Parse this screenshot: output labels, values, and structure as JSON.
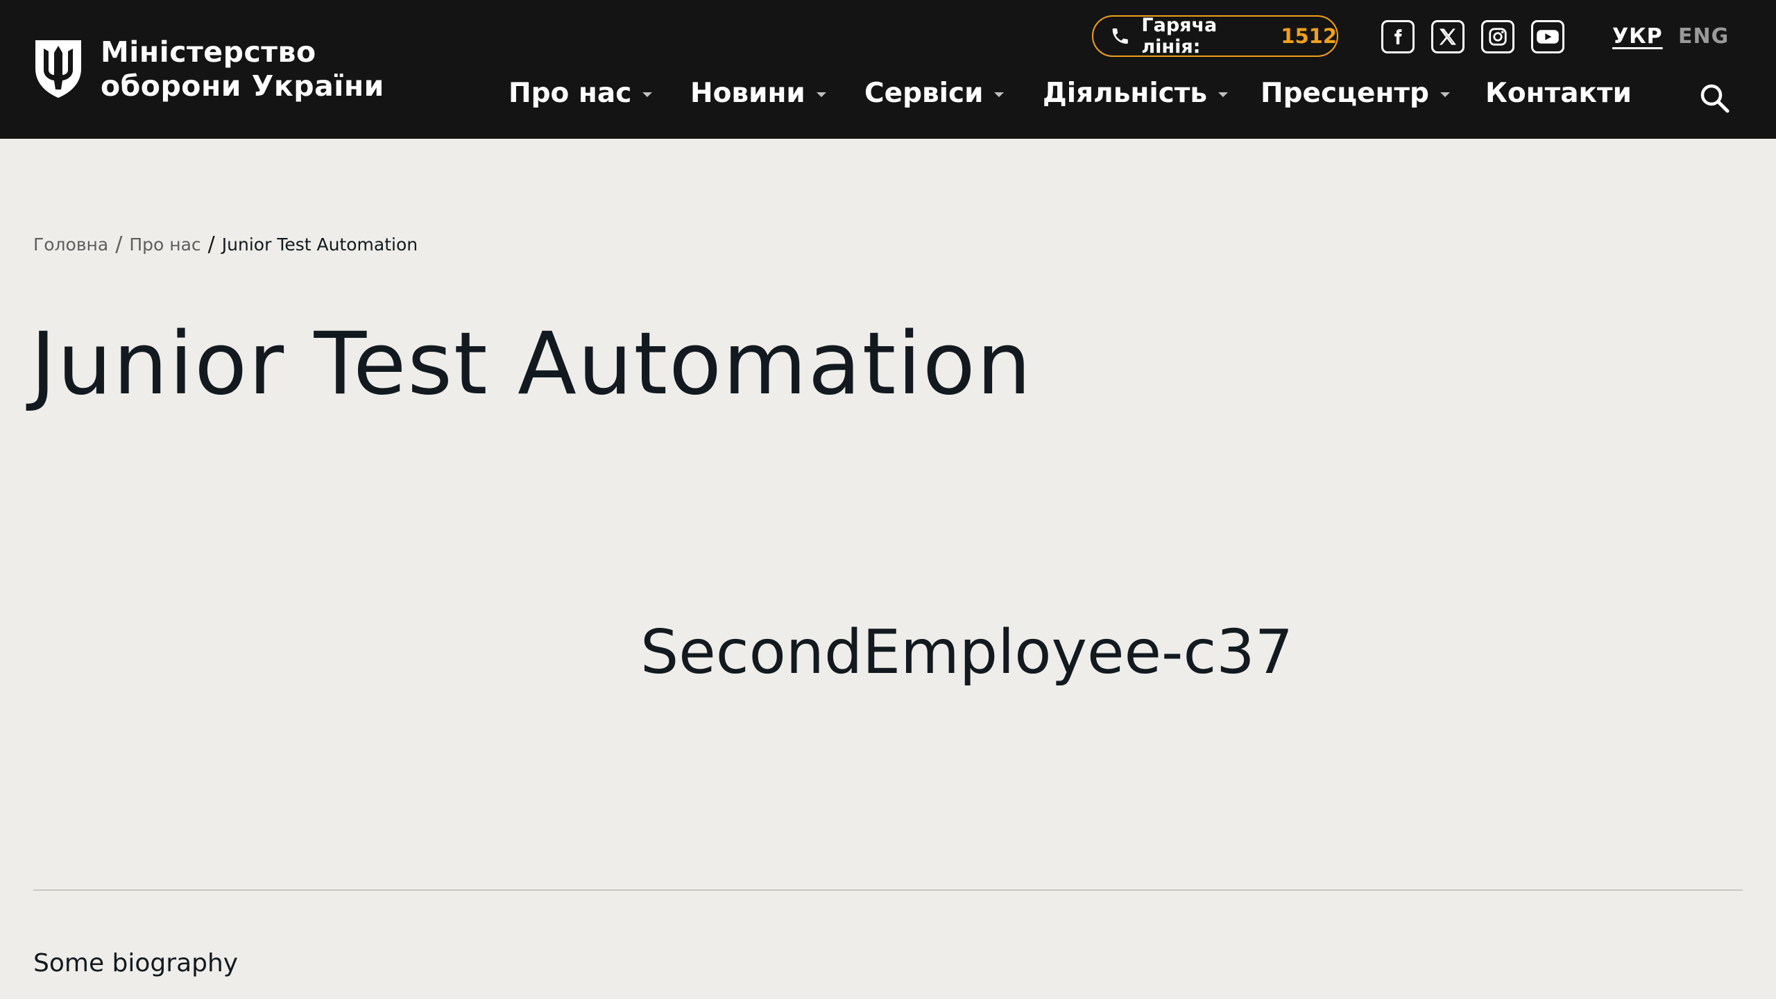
{
  "header": {
    "logo": {
      "line1": "Міністерство",
      "line2": "оборони України"
    },
    "hotline": {
      "label": "Гаряча лінія:",
      "number": "1512"
    },
    "social": [
      {
        "name": "facebook-icon"
      },
      {
        "name": "x-twitter-icon"
      },
      {
        "name": "instagram-icon"
      },
      {
        "name": "youtube-icon"
      }
    ],
    "languages": {
      "active": "УКР",
      "other": "ENG"
    },
    "nav": [
      {
        "label": "Про нас",
        "has_dropdown": true
      },
      {
        "label": "Новини",
        "has_dropdown": true
      },
      {
        "label": "Сервіси",
        "has_dropdown": true
      },
      {
        "label": "Діяльність",
        "has_dropdown": true
      },
      {
        "label": "Пресцентр",
        "has_dropdown": true
      },
      {
        "label": "Контакти",
        "has_dropdown": false
      }
    ]
  },
  "breadcrumb": {
    "home": "Головна",
    "parent": "Про нас",
    "current": "Junior Test Automation",
    "separator": "/"
  },
  "page": {
    "title": "Junior Test Automation",
    "employee_name": "SecondEmployee-c37",
    "biography": "Some biography"
  },
  "colors": {
    "header_bg": "#141414",
    "page_bg": "#EEEDE9",
    "accent": "#F2A019",
    "text": "#121A20"
  }
}
